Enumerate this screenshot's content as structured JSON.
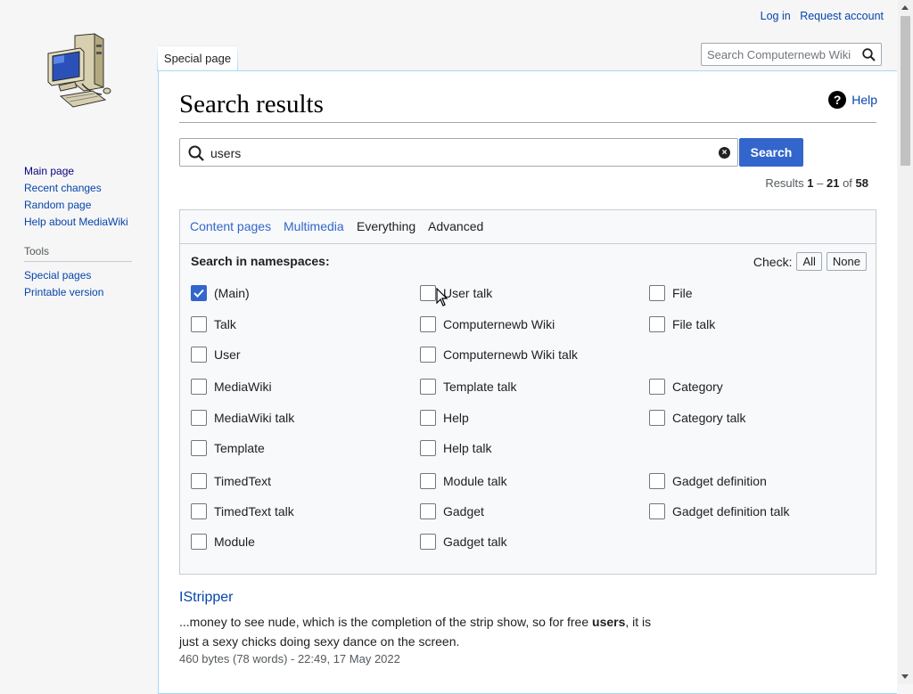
{
  "personal": {
    "login": "Log in",
    "request_account": "Request account"
  },
  "sidebar": {
    "nav": [
      "Main page",
      "Recent changes",
      "Random page",
      "Help about MediaWiki"
    ],
    "tools_heading": "Tools",
    "tools": [
      "Special pages",
      "Printable version"
    ]
  },
  "tabs": {
    "special_page": "Special page"
  },
  "header_search": {
    "placeholder": "Search Computernewb Wiki"
  },
  "page": {
    "title": "Search results",
    "help": "Help"
  },
  "search": {
    "query": "users",
    "button": "Search"
  },
  "results_info": {
    "prefix": "Results ",
    "start": "1",
    "sep": " – ",
    "end": "21",
    "of": " of ",
    "total": "58"
  },
  "advanced": {
    "tabs": [
      "Content pages",
      "Multimedia",
      "Everything",
      "Advanced"
    ],
    "namespaces_heading": "Search in namespaces:",
    "check_label": "Check:",
    "all": "All",
    "none": "None",
    "namespaces": [
      {
        "label": "(Main)",
        "checked": true
      },
      {
        "label": "User talk",
        "checked": false
      },
      {
        "label": "File",
        "checked": false
      },
      {
        "label": "Talk",
        "checked": false
      },
      {
        "label": "Computernewb Wiki",
        "checked": false
      },
      {
        "label": "File talk",
        "checked": false
      },
      {
        "label": "User",
        "checked": false
      },
      {
        "label": "Computernewb Wiki talk",
        "checked": false
      },
      {
        "label": "MediaWiki",
        "checked": false
      },
      {
        "label": "Template talk",
        "checked": false
      },
      {
        "label": "Category",
        "checked": false
      },
      {
        "label": "MediaWiki talk",
        "checked": false
      },
      {
        "label": "Help",
        "checked": false
      },
      {
        "label": "Category talk",
        "checked": false
      },
      {
        "label": "Template",
        "checked": false
      },
      {
        "label": "Help talk",
        "checked": false
      },
      {
        "label": "TimedText",
        "checked": false
      },
      {
        "label": "Module talk",
        "checked": false
      },
      {
        "label": "Gadget definition",
        "checked": false
      },
      {
        "label": "TimedText talk",
        "checked": false
      },
      {
        "label": "Gadget",
        "checked": false
      },
      {
        "label": "Gadget definition talk",
        "checked": false
      },
      {
        "label": "Module",
        "checked": false
      },
      {
        "label": "Gadget talk",
        "checked": false
      }
    ]
  },
  "result": {
    "title": "IStripper",
    "snippet_before": "...money to see nude, which is the completion of the strip show, so for free ",
    "snippet_match": "users",
    "snippet_after": ", it is just a sexy chicks doing sexy dance on the screen.",
    "meta": "460 bytes (78 words) - 22:49, 17 May 2022"
  },
  "colors": {
    "link": "#0645ad",
    "accent": "#3366cc",
    "border": "#a7d7f9"
  },
  "icons": [
    "computer-logo",
    "search-icon",
    "clear-icon",
    "help-icon",
    "checkmark-icon",
    "mouse-cursor"
  ]
}
